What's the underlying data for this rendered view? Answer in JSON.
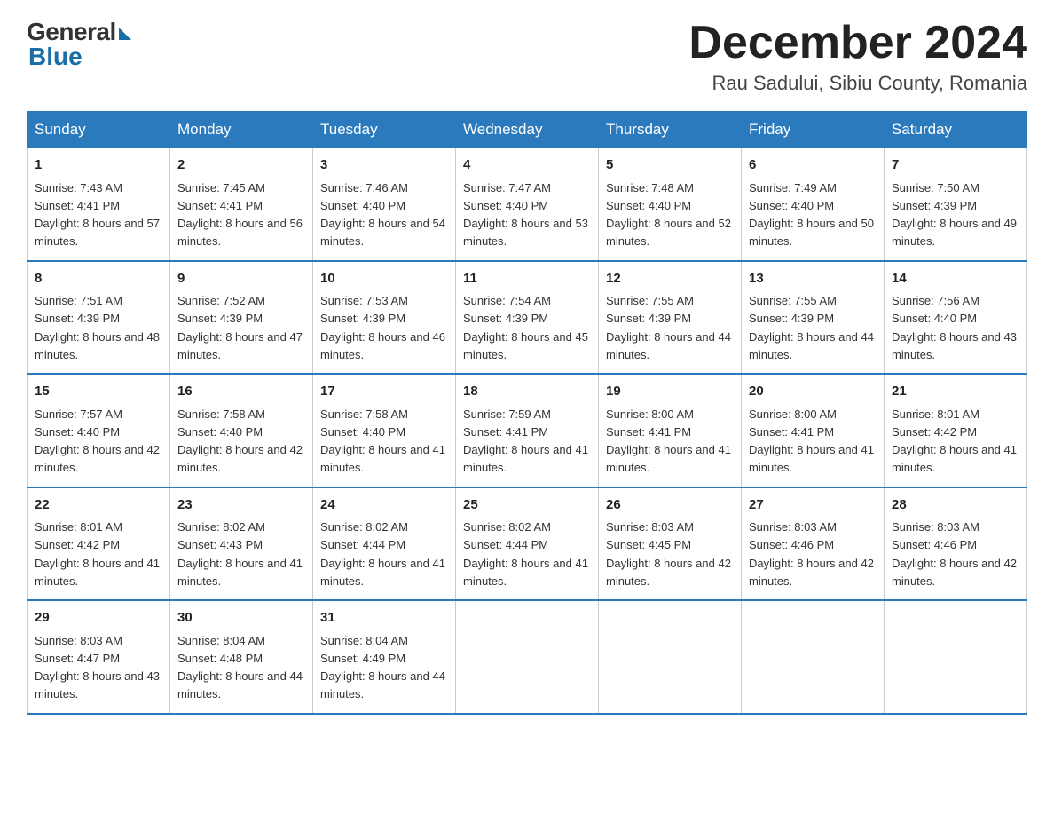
{
  "header": {
    "logo_general": "General",
    "logo_blue": "Blue",
    "month_title": "December 2024",
    "location": "Rau Sadului, Sibiu County, Romania"
  },
  "weekdays": [
    "Sunday",
    "Monday",
    "Tuesday",
    "Wednesday",
    "Thursday",
    "Friday",
    "Saturday"
  ],
  "weeks": [
    [
      {
        "day": "1",
        "sunrise": "7:43 AM",
        "sunset": "4:41 PM",
        "daylight": "8 hours and 57 minutes."
      },
      {
        "day": "2",
        "sunrise": "7:45 AM",
        "sunset": "4:41 PM",
        "daylight": "8 hours and 56 minutes."
      },
      {
        "day": "3",
        "sunrise": "7:46 AM",
        "sunset": "4:40 PM",
        "daylight": "8 hours and 54 minutes."
      },
      {
        "day": "4",
        "sunrise": "7:47 AM",
        "sunset": "4:40 PM",
        "daylight": "8 hours and 53 minutes."
      },
      {
        "day": "5",
        "sunrise": "7:48 AM",
        "sunset": "4:40 PM",
        "daylight": "8 hours and 52 minutes."
      },
      {
        "day": "6",
        "sunrise": "7:49 AM",
        "sunset": "4:40 PM",
        "daylight": "8 hours and 50 minutes."
      },
      {
        "day": "7",
        "sunrise": "7:50 AM",
        "sunset": "4:39 PM",
        "daylight": "8 hours and 49 minutes."
      }
    ],
    [
      {
        "day": "8",
        "sunrise": "7:51 AM",
        "sunset": "4:39 PM",
        "daylight": "8 hours and 48 minutes."
      },
      {
        "day": "9",
        "sunrise": "7:52 AM",
        "sunset": "4:39 PM",
        "daylight": "8 hours and 47 minutes."
      },
      {
        "day": "10",
        "sunrise": "7:53 AM",
        "sunset": "4:39 PM",
        "daylight": "8 hours and 46 minutes."
      },
      {
        "day": "11",
        "sunrise": "7:54 AM",
        "sunset": "4:39 PM",
        "daylight": "8 hours and 45 minutes."
      },
      {
        "day": "12",
        "sunrise": "7:55 AM",
        "sunset": "4:39 PM",
        "daylight": "8 hours and 44 minutes."
      },
      {
        "day": "13",
        "sunrise": "7:55 AM",
        "sunset": "4:39 PM",
        "daylight": "8 hours and 44 minutes."
      },
      {
        "day": "14",
        "sunrise": "7:56 AM",
        "sunset": "4:40 PM",
        "daylight": "8 hours and 43 minutes."
      }
    ],
    [
      {
        "day": "15",
        "sunrise": "7:57 AM",
        "sunset": "4:40 PM",
        "daylight": "8 hours and 42 minutes."
      },
      {
        "day": "16",
        "sunrise": "7:58 AM",
        "sunset": "4:40 PM",
        "daylight": "8 hours and 42 minutes."
      },
      {
        "day": "17",
        "sunrise": "7:58 AM",
        "sunset": "4:40 PM",
        "daylight": "8 hours and 41 minutes."
      },
      {
        "day": "18",
        "sunrise": "7:59 AM",
        "sunset": "4:41 PM",
        "daylight": "8 hours and 41 minutes."
      },
      {
        "day": "19",
        "sunrise": "8:00 AM",
        "sunset": "4:41 PM",
        "daylight": "8 hours and 41 minutes."
      },
      {
        "day": "20",
        "sunrise": "8:00 AM",
        "sunset": "4:41 PM",
        "daylight": "8 hours and 41 minutes."
      },
      {
        "day": "21",
        "sunrise": "8:01 AM",
        "sunset": "4:42 PM",
        "daylight": "8 hours and 41 minutes."
      }
    ],
    [
      {
        "day": "22",
        "sunrise": "8:01 AM",
        "sunset": "4:42 PM",
        "daylight": "8 hours and 41 minutes."
      },
      {
        "day": "23",
        "sunrise": "8:02 AM",
        "sunset": "4:43 PM",
        "daylight": "8 hours and 41 minutes."
      },
      {
        "day": "24",
        "sunrise": "8:02 AM",
        "sunset": "4:44 PM",
        "daylight": "8 hours and 41 minutes."
      },
      {
        "day": "25",
        "sunrise": "8:02 AM",
        "sunset": "4:44 PM",
        "daylight": "8 hours and 41 minutes."
      },
      {
        "day": "26",
        "sunrise": "8:03 AM",
        "sunset": "4:45 PM",
        "daylight": "8 hours and 42 minutes."
      },
      {
        "day": "27",
        "sunrise": "8:03 AM",
        "sunset": "4:46 PM",
        "daylight": "8 hours and 42 minutes."
      },
      {
        "day": "28",
        "sunrise": "8:03 AM",
        "sunset": "4:46 PM",
        "daylight": "8 hours and 42 minutes."
      }
    ],
    [
      {
        "day": "29",
        "sunrise": "8:03 AM",
        "sunset": "4:47 PM",
        "daylight": "8 hours and 43 minutes."
      },
      {
        "day": "30",
        "sunrise": "8:04 AM",
        "sunset": "4:48 PM",
        "daylight": "8 hours and 44 minutes."
      },
      {
        "day": "31",
        "sunrise": "8:04 AM",
        "sunset": "4:49 PM",
        "daylight": "8 hours and 44 minutes."
      },
      null,
      null,
      null,
      null
    ]
  ]
}
